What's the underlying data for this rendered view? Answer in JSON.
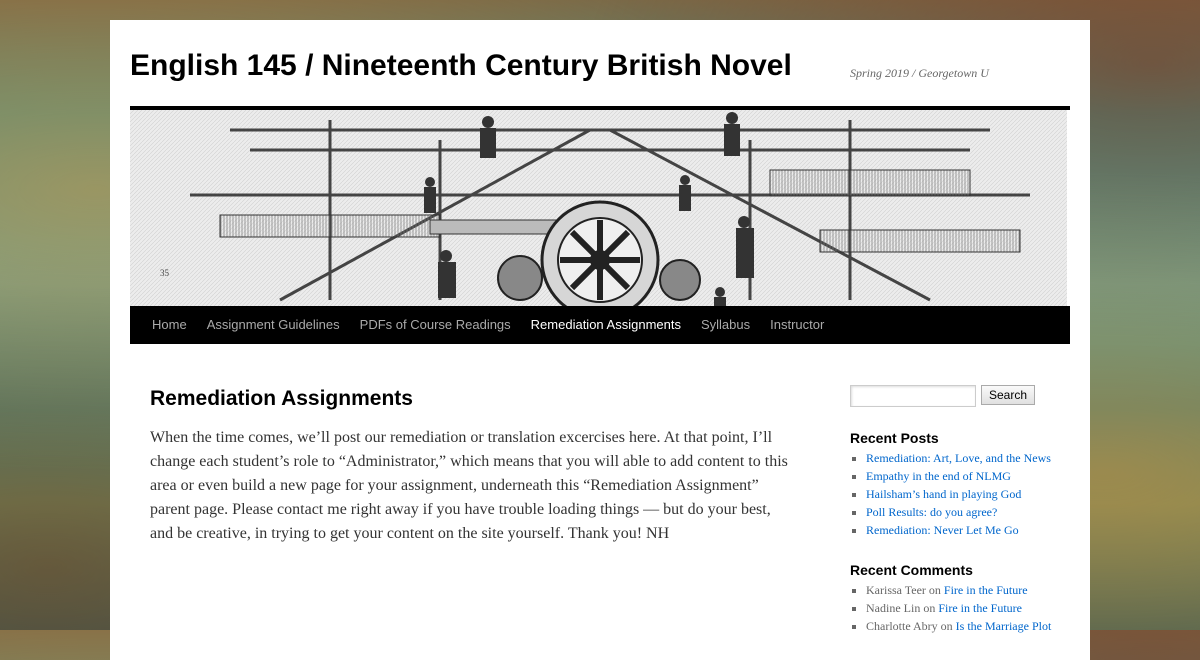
{
  "site": {
    "title": "English 145 / Nineteenth Century British Novel",
    "description": "Spring 2019 / Georgetown U"
  },
  "nav": {
    "items": [
      {
        "label": "Home"
      },
      {
        "label": "Assignment Guidelines"
      },
      {
        "label": "PDFs of Course Readings"
      },
      {
        "label": "Remediation Assignments"
      },
      {
        "label": "Syllabus"
      },
      {
        "label": "Instructor"
      }
    ],
    "current": "Remediation Assignments"
  },
  "main": {
    "title": "Remediation Assignments",
    "body": "When the time comes, we’ll post our remediation or translation excercises here. At that point, I’ll change each student’s role to “Administrator,” which means that you will able to add content to this area or even build a new page for your assignment, underneath this “Remediation Assignment” parent page. Please contact me right away if you have trouble loading things — but do your best, and be creative, in trying to get your content on the site yourself. Thank you! NH"
  },
  "sidebar": {
    "search": {
      "placeholder": "",
      "button_label": "Search"
    },
    "recent_posts": {
      "title": "Recent Posts",
      "items": [
        {
          "label": "Remediation: Art, Love, and the News"
        },
        {
          "label": "Empathy in the end of NLMG"
        },
        {
          "label": "Hailsham’s hand in playing God"
        },
        {
          "label": "Poll Results: do you agree?"
        },
        {
          "label": "Remediation: Never Let Me Go"
        }
      ]
    },
    "recent_comments": {
      "title": "Recent Comments",
      "items": [
        {
          "author": "Karissa Teer",
          "on": "on",
          "post": "Fire in the Future"
        },
        {
          "author": "Nadine Lin",
          "on": "on",
          "post": "Fire in the Future"
        },
        {
          "author": "Charlotte Abry",
          "on": "on",
          "post": "Is the Marriage Plot"
        }
      ]
    }
  },
  "colors": {
    "link": "#0066cc",
    "nav_background": "#000000",
    "nav_current": "#ffffff",
    "nav_text": "#aaaaaa"
  }
}
